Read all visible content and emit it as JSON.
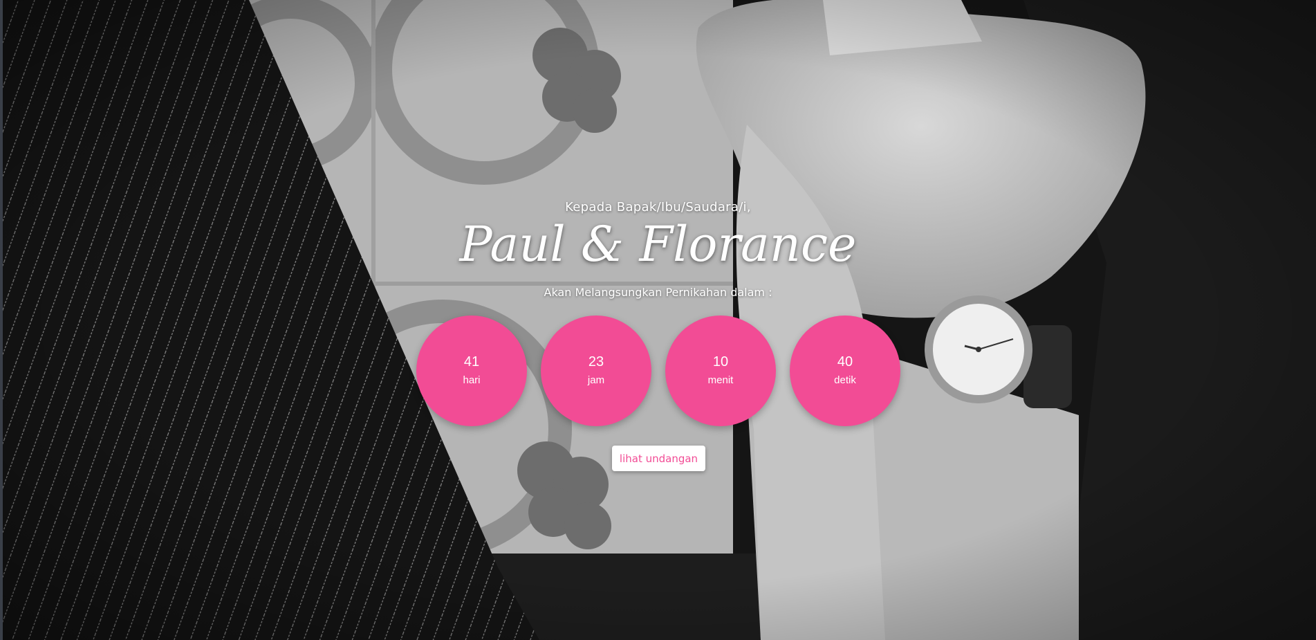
{
  "theme": {
    "accent": "#f24c95",
    "button_text": "#f24c95",
    "background": "#111111"
  },
  "hero": {
    "greeting": "Kepada Bapak/Ibu/Saudara/i,",
    "couple_names": "Paul & Florance",
    "subtitle": "Akan Melangsungkan Pernikahan dalam :",
    "background_image": "black-and-white-photo-holding-hands-wristwatch"
  },
  "countdown": [
    {
      "value": "41",
      "label": "hari"
    },
    {
      "value": "23",
      "label": "jam"
    },
    {
      "value": "10",
      "label": "menit"
    },
    {
      "value": "40",
      "label": "detik"
    }
  ],
  "cta": {
    "label": "lihat undangan"
  }
}
